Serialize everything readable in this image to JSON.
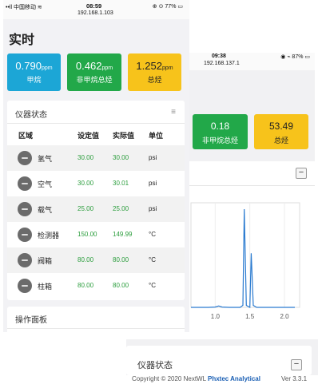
{
  "back_screen": {
    "status_time": "09:38",
    "status_ip": "192.168.137.1",
    "status_icons": "◉ ⌁ 87% ▭",
    "cards": [
      {
        "value": "0.18",
        "label": "非甲烷总烃",
        "color": "#22a849"
      },
      {
        "value": "53.49",
        "label": "总烃",
        "color": "#f7c31b"
      }
    ],
    "collapse_symbol": "−",
    "chart_data": {
      "type": "line",
      "title": "",
      "xlabel": "",
      "ylabel": "",
      "x_ticks": [
        "1.0",
        "1.5",
        "2.0"
      ],
      "xlim": [
        0.65,
        2.15
      ],
      "series": [
        {
          "x": [
            0.65,
            0.8,
            0.9,
            1.0,
            1.05,
            1.1,
            1.2,
            1.3,
            1.36,
            1.4,
            1.42,
            1.45,
            1.5,
            1.52,
            1.55,
            1.6,
            1.7,
            1.8,
            1.9,
            2.0,
            2.15
          ],
          "values": [
            0,
            0,
            0,
            0.3,
            1.5,
            0.3,
            0,
            0,
            0,
            2,
            100,
            2,
            0,
            55,
            2,
            0,
            0,
            0,
            0,
            0,
            0
          ]
        }
      ]
    },
    "lower_panel_title": "仪器状态"
  },
  "footer": {
    "copyright_prefix": "Copyright © 2020 NextWL",
    "company": "Phxtec Analytical",
    "version": "Ver 3.3.1"
  },
  "front_screen": {
    "status_carrier": "••ll 中国移动 ≋",
    "status_time": "08:59",
    "status_ip": "192.168.1.103",
    "status_battery": "⊕ ⊙ 77% ▭",
    "title": "实时",
    "cards": [
      {
        "value": "0.790",
        "unit": "ppm",
        "label": "甲烷",
        "color": "#1ca6d6"
      },
      {
        "value": "0.462",
        "unit": "ppm",
        "label": "非甲烷总烃",
        "color": "#22a849"
      },
      {
        "value": "1.252",
        "unit": "ppm",
        "label": "总烃",
        "color": "#f7c31b"
      }
    ],
    "instrument_panel": {
      "title": "仪器状态",
      "menu_icon": "≡",
      "headers": {
        "zone": "区域",
        "set": "设定值",
        "actual": "实际值",
        "unit": "单位"
      },
      "rows": [
        {
          "name": "氢气",
          "set": "30.00",
          "actual": "30.00",
          "unit": "psi"
        },
        {
          "name": "空气",
          "set": "30.00",
          "actual": "30.01",
          "unit": "psi"
        },
        {
          "name": "载气",
          "set": "25.00",
          "actual": "25.00",
          "unit": "psi"
        },
        {
          "name": "检测器",
          "set": "150.00",
          "actual": "149.99",
          "unit": "°C"
        },
        {
          "name": "阀箱",
          "set": "80.00",
          "actual": "80.00",
          "unit": "°C"
        },
        {
          "name": "柱箱",
          "set": "80.00",
          "actual": "80.00",
          "unit": "°C"
        }
      ]
    },
    "operation_panel": {
      "title": "操作面板"
    }
  }
}
